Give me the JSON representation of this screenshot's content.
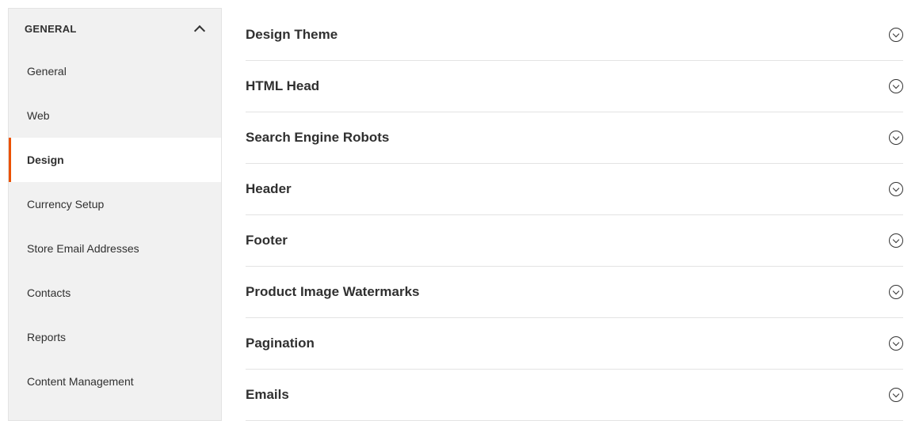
{
  "sidebar": {
    "group_title": "GENERAL",
    "items": [
      {
        "label": "General",
        "active": false
      },
      {
        "label": "Web",
        "active": false
      },
      {
        "label": "Design",
        "active": true
      },
      {
        "label": "Currency Setup",
        "active": false
      },
      {
        "label": "Store Email Addresses",
        "active": false
      },
      {
        "label": "Contacts",
        "active": false
      },
      {
        "label": "Reports",
        "active": false
      },
      {
        "label": "Content Management",
        "active": false
      }
    ]
  },
  "sections": [
    {
      "title": "Design Theme"
    },
    {
      "title": "HTML Head"
    },
    {
      "title": "Search Engine Robots"
    },
    {
      "title": "Header"
    },
    {
      "title": "Footer"
    },
    {
      "title": "Product Image Watermarks"
    },
    {
      "title": "Pagination"
    },
    {
      "title": "Emails"
    }
  ]
}
